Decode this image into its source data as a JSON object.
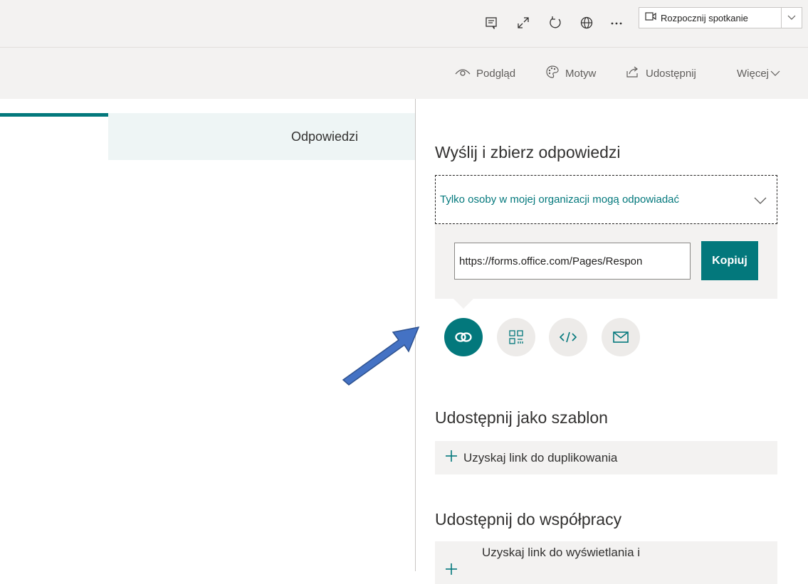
{
  "top_toolbar": {
    "icons": [
      "comment-icon",
      "expand-icon",
      "refresh-icon",
      "globe-icon",
      "more-icon"
    ],
    "meeting_button_label": "Rozpocznij spotkanie",
    "meeting_icon": "video-icon"
  },
  "second_toolbar": {
    "preview_label": "Podgląd",
    "theme_label": "Motyw",
    "share_label": "Udostępnij",
    "more_label": "Więcej"
  },
  "tabs": {
    "responses_label": "Odpowiedzi"
  },
  "panel": {
    "send_title": "Wyślij i zbierz odpowiedzi",
    "audience_value": "Tylko osoby w mojej organizacji mogą odpowiadać",
    "link_value": "https://forms.office.com/Pages/Respon",
    "copy_label": "Kopiuj",
    "share_methods": [
      "link-icon",
      "qr-code-icon",
      "embed-code-icon",
      "email-icon"
    ],
    "template_title": "Udostępnij jako szablon",
    "duplicate_link_label": "Uzyskaj link do duplikowania",
    "collab_title": "Udostępnij do współpracy",
    "view_link_label": "Uzyskaj link do wyświetlania i"
  },
  "colors": {
    "accent": "#03787c",
    "annotation_arrow": "#4472c4"
  }
}
